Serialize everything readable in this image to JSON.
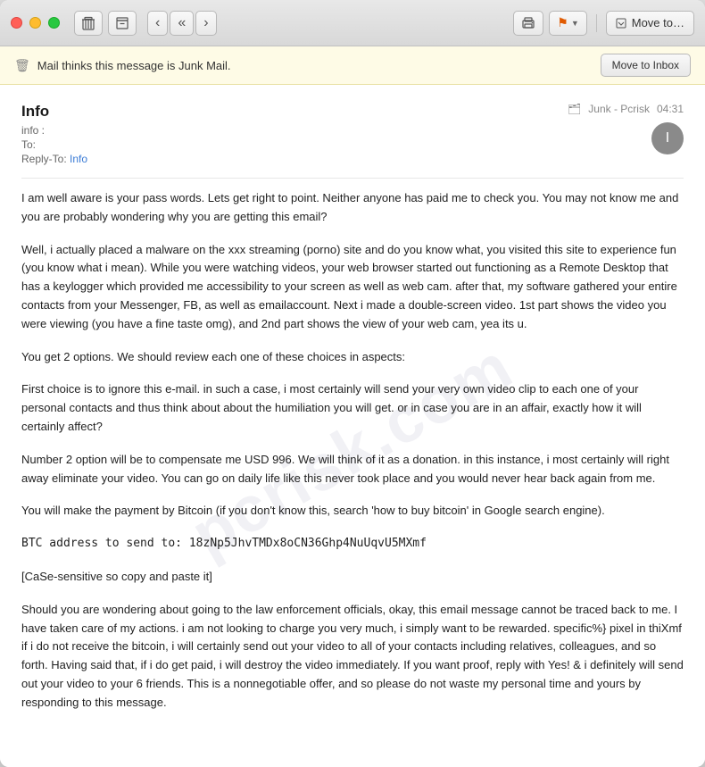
{
  "window": {
    "title": "Info"
  },
  "toolbar": {
    "trash_label": "🗑",
    "archive_label": "📥",
    "back_label": "‹",
    "back_back_label": "«",
    "forward_label": "›",
    "print_label": "🖨",
    "flag_label": "⚑",
    "move_to_label": "Move to…"
  },
  "junk_bar": {
    "icon": "🗑",
    "message": "Mail thinks this message is Junk Mail.",
    "button": "Move to Inbox"
  },
  "email": {
    "sender": "Info",
    "from_label": "info :",
    "to_label": "To:",
    "reply_to_label": "Reply-To:",
    "reply_to_value": "Info",
    "folder": "Junk - Pcrisk",
    "time": "04:31",
    "avatar_letter": "I",
    "body_paragraphs": [
      "I am well aware            is your pass words. Lets get right to point. Neither anyone has paid me to check you. You may not know me and you are probably wondering why you are getting this email?",
      "Well, i actually placed a malware on the xxx streaming (porno) site and do you know what, you visited this site to experience fun (you know what i mean). While you were watching videos, your web browser started out functioning as a Remote Desktop that has a keylogger which provided me accessibility to your screen as well as web cam. after that, my software gathered your entire contacts from your Messenger, FB, as well as emailaccount. Next i made a double-screen video. 1st part shows the video you were viewing (you have a fine taste omg), and 2nd part shows the view of your web cam, yea its u.",
      "You get 2 options. We should review each one of these choices in aspects:",
      "First choice is to ignore this e-mail. in such a case, i most certainly will send your very own video clip to each one of your personal contacts and thus think about about the humiliation you will get. or in case you are in an affair, exactly how it will certainly affect?",
      "Number 2 option will be to compensate me USD 996. We will think of it as a donation. in this instance, i most certainly will right away eliminate your video. You can go on daily life like this never took place and you would never hear back again from me.",
      "You will make the payment by Bitcoin (if you don't know this, search 'how to buy bitcoin' in Google search engine).",
      "BTC address to send to: 18zNp5JhvTMDx8oCN36Ghp4NuUqvU5MXmf",
      "[CaSe-sensitive so copy and paste it]",
      "Should you are wondering about going to the law enforcement officials, okay, this email message cannot be traced back to me. I have taken care of my actions. i am not looking to charge you very much, i simply want to be rewarded. specific%} pixel in thiXmf if i do not receive the bitcoin, i will certainly send out your video to all of your contacts including relatives, colleagues, and so forth. Having said that, if i do get paid, i will destroy the video immediately. If you want proof, reply with Yes! & i definitely will send out your video to your 6 friends. This is a nonnegotiable offer, and so please do not waste my personal time and yours by responding to this message."
    ],
    "watermark": "pcrisk.com"
  }
}
